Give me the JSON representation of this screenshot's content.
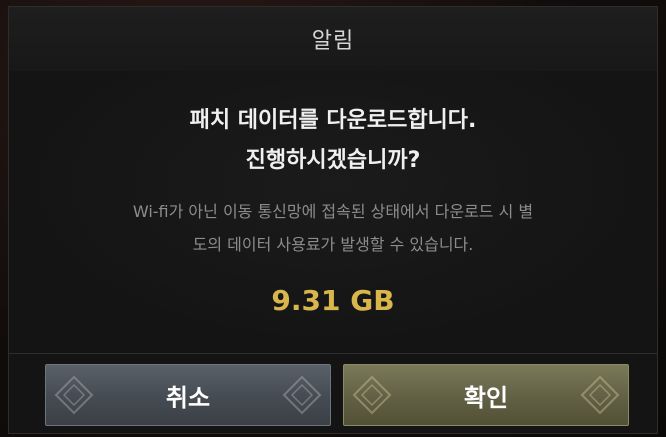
{
  "dialog": {
    "title": "알림",
    "headline_line1": "패치 데이터를 다운로드합니다.",
    "headline_line2": "진행하시겠습니까?",
    "notice_line1": "Wi-fi가 아닌 이동 통신망에 접속된 상태에서 다운로드 시 별",
    "notice_line2": "도의 데이터 사용료가 발생할 수 있습니다.",
    "download_size": "9.31 GB",
    "size_color": "#d9b64c"
  },
  "buttons": {
    "cancel_label": "취소",
    "confirm_label": "확인"
  },
  "icons": {
    "button_ornament": "diamond-ornament-icon"
  }
}
